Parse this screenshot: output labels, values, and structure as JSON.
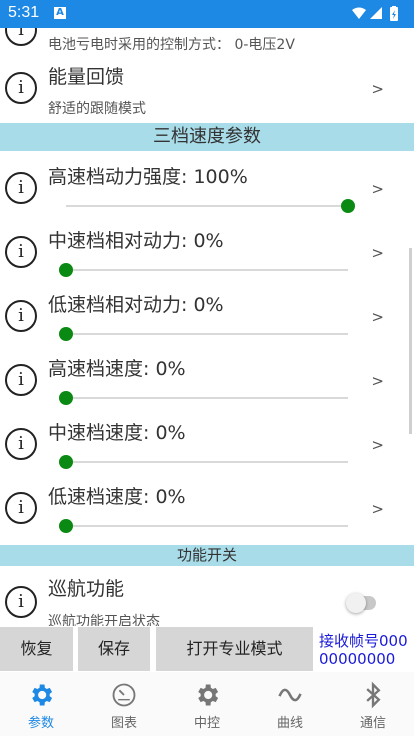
{
  "status_bar": {
    "time": "5:31",
    "app_badge": "A"
  },
  "rows_top": [
    {
      "subtitle": "电池亏电时采用的控制方式： 0-电压2V"
    },
    {
      "title": "能量回馈",
      "subtitle": "舒适的跟随模式",
      "chevron": ">"
    }
  ],
  "section_speed": {
    "title": "三档速度参数"
  },
  "slider_rows": [
    {
      "title": "高速档动力强度: 100%",
      "chevron": ">",
      "value_percent": 100
    },
    {
      "title": "中速档相对动力: 0%",
      "chevron": ">",
      "value_percent": 0
    },
    {
      "title": "低速档相对动力: 0%",
      "chevron": ">",
      "value_percent": 0
    },
    {
      "title": "高速档速度: 0%",
      "chevron": ">",
      "value_percent": 0
    },
    {
      "title": "中速档速度: 0%",
      "chevron": ">",
      "value_percent": 0
    },
    {
      "title": "低速档速度: 0%",
      "chevron": ">",
      "value_percent": 0
    }
  ],
  "section_switch": {
    "title": "功能开关"
  },
  "cruise": {
    "title": "巡航功能",
    "subtitle": "巡航功能开启状态",
    "enabled": false
  },
  "info_glyph": "i",
  "buttons": {
    "restore": "恢复",
    "save": "保存",
    "pro_mode": "打开专业模式"
  },
  "frame_counter": {
    "label": "接收帧号00000000000"
  },
  "nav": [
    {
      "label": "参数",
      "icon": "gear-icon",
      "active": true
    },
    {
      "label": "图表",
      "icon": "gauge-icon",
      "active": false
    },
    {
      "label": "中控",
      "icon": "gear-icon",
      "active": false
    },
    {
      "label": "曲线",
      "icon": "wave-icon",
      "active": false
    },
    {
      "label": "通信",
      "icon": "bluetooth-icon",
      "active": false
    }
  ],
  "colors": {
    "primary": "#1e88e5",
    "section_bg": "#a8dce9",
    "slider_thumb": "#0a8a12",
    "frame_text": "#1a1ad9"
  }
}
